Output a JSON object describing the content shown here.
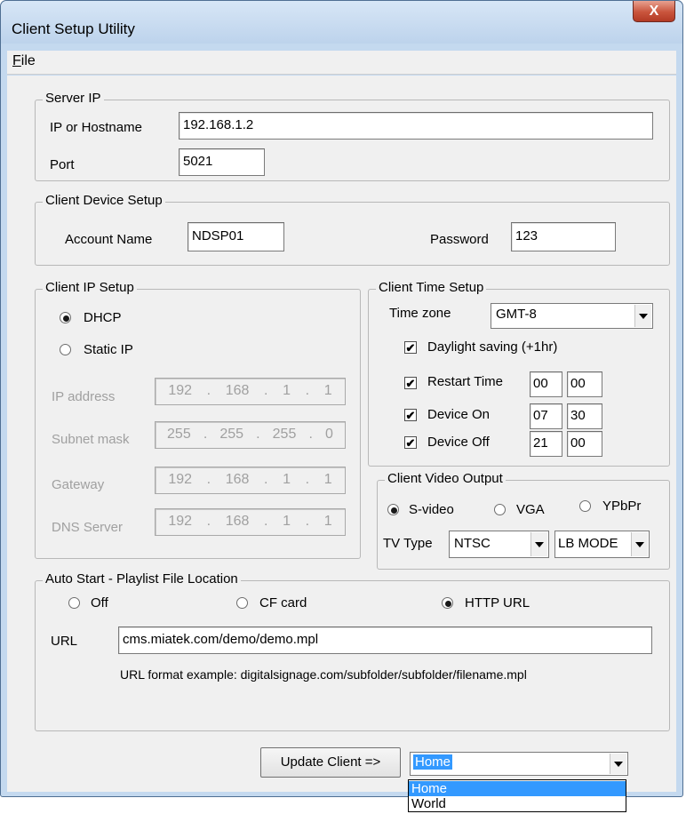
{
  "window": {
    "title": "Client Setup Utility",
    "close_glyph": "X"
  },
  "menu": {
    "file_accel": "F",
    "file_rest": "ile"
  },
  "server_ip": {
    "legend": "Server IP",
    "host_label": "IP or Hostname",
    "host_value": "192.168.1.2",
    "port_label": "Port",
    "port_value": "5021"
  },
  "device": {
    "legend": "Client Device Setup",
    "account_label": "Account Name",
    "account_value": "NDSP01",
    "password_label": "Password",
    "password_value": "123"
  },
  "ip_setup": {
    "legend": "Client IP Setup",
    "dhcp_label": "DHCP",
    "static_label": "Static IP",
    "selected": "DHCP",
    "rows": [
      {
        "label": "IP address",
        "octets": [
          "192",
          "168",
          "1",
          "1"
        ]
      },
      {
        "label": "Subnet mask",
        "octets": [
          "255",
          "255",
          "255",
          "0"
        ]
      },
      {
        "label": "Gateway",
        "octets": [
          "192",
          "168",
          "1",
          "1"
        ]
      },
      {
        "label": "DNS Server",
        "octets": [
          "192",
          "168",
          "1",
          "1"
        ]
      }
    ]
  },
  "time_setup": {
    "legend": "Client Time Setup",
    "timezone_label": "Time zone",
    "timezone_value": "GMT-8",
    "daylight_label": "Daylight saving (+1hr)",
    "restart_label": "Restart Time",
    "restart_h": "00",
    "restart_m": "00",
    "on_label": "Device On",
    "on_h": "07",
    "on_m": "30",
    "off_label": "Device Off",
    "off_h": "21",
    "off_m": "00"
  },
  "video": {
    "legend": "Client Video Output",
    "svideo_label": "S-video",
    "vga_label": "VGA",
    "ypbpr_label": "YPbPr",
    "selected": "S-video",
    "tvtype_label": "TV Type",
    "tvtype_value": "NTSC",
    "mode_value": "LB MODE"
  },
  "autostart": {
    "legend": "Auto Start - Playlist File Location",
    "off_label": "Off",
    "cf_label": "CF card",
    "http_label": "HTTP URL",
    "selected": "HTTP URL",
    "url_label": "URL",
    "url_value": "cms.miatek.com/demo/demo.mpl",
    "url_hint": "URL format example: digitalsignage.com/subfolder/subfolder/filename.mpl"
  },
  "footer": {
    "update_label": "Update Client =>",
    "target_value": "Home",
    "target_options": [
      "Home",
      "World"
    ]
  }
}
